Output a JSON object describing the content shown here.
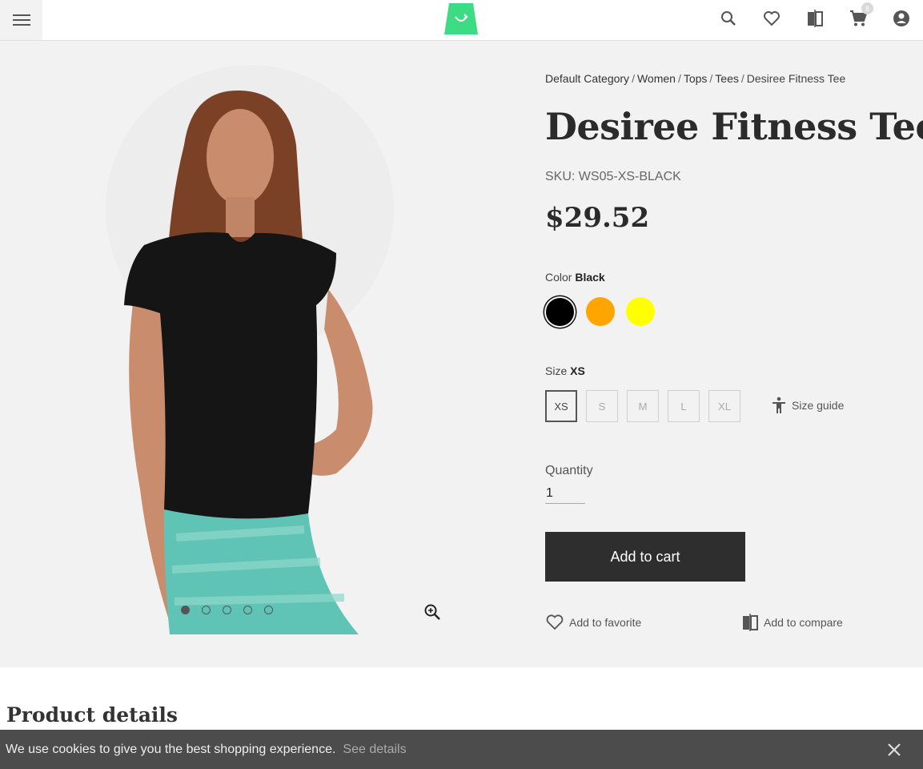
{
  "header": {
    "menu_icon": "hamburger-menu-icon",
    "logo": "shopping-bag-logo",
    "icons": [
      "search-icon",
      "heart-icon",
      "compare-icon",
      "cart-icon",
      "account-icon"
    ],
    "cart_count": "8"
  },
  "breadcrumb": {
    "items": [
      "Default Category",
      "Women",
      "Tops",
      "Tees",
      "Desiree Fitness Tee"
    ],
    "separator": "/"
  },
  "product": {
    "title": "Desiree Fitness Tee",
    "sku": "SKU: WS05-XS-BLACK",
    "price": "$29.52",
    "color_label": "Color",
    "color_value": "Black",
    "colors": [
      {
        "name": "Black",
        "hex": "#000000",
        "selected": true
      },
      {
        "name": "Orange",
        "hex": "#ffa500",
        "selected": false
      },
      {
        "name": "Yellow",
        "hex": "#ffff00",
        "selected": false
      }
    ],
    "size_label": "Size",
    "size_value": "XS",
    "sizes": [
      "XS",
      "S",
      "M",
      "L",
      "XL"
    ],
    "size_guide": "Size guide",
    "quantity_label": "Quantity",
    "quantity_value": "1",
    "add_to_cart": "Add to cart",
    "add_to_favorite": "Add to favorite",
    "add_to_compare": "Add to compare"
  },
  "gallery": {
    "image_count": 5,
    "active_index": 0
  },
  "details": {
    "title": "Product details"
  },
  "cookie": {
    "text": "We use cookies to give you the best shopping experience.",
    "link": "See details"
  },
  "colors": {
    "background": "#f2f2f2",
    "button": "#2e2e2e",
    "logo": "#3ddc84",
    "cookie_bar": "#4c4c4c"
  }
}
